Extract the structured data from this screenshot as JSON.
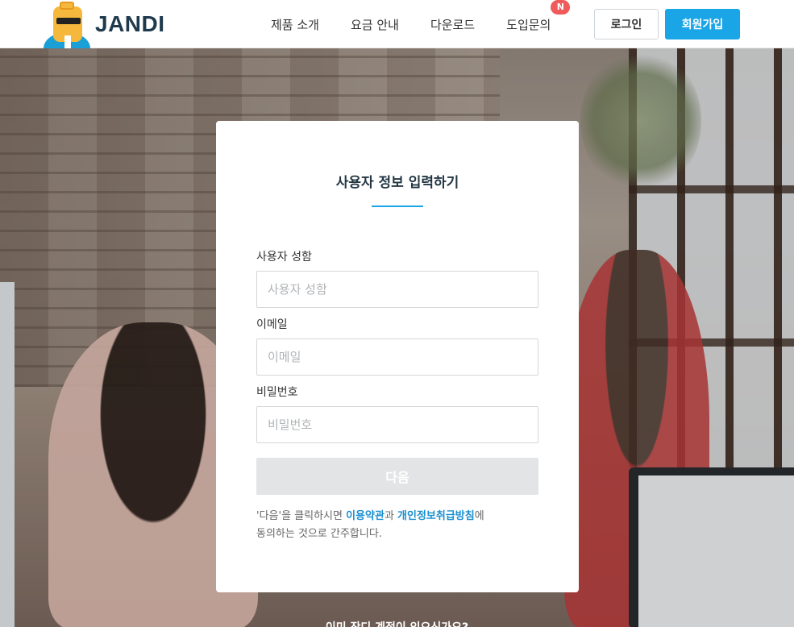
{
  "header": {
    "logo_text": "JANDI",
    "nav": [
      {
        "label": "제품 소개"
      },
      {
        "label": "요금 안내"
      },
      {
        "label": "다운로드"
      },
      {
        "label": "도입문의",
        "badge": "N"
      }
    ],
    "login_label": "로그인",
    "signup_label": "회원가입"
  },
  "form": {
    "title": "사용자 정보 입력하기",
    "fields": [
      {
        "label": "사용자 성함",
        "placeholder": "사용자 성함",
        "value": ""
      },
      {
        "label": "이메일",
        "placeholder": "이메일",
        "value": ""
      },
      {
        "label": "비밀번호",
        "placeholder": "비밀번호",
        "value": ""
      }
    ],
    "next_label": "다음",
    "terms": {
      "prefix": "'다음'을 클릭하시면 ",
      "link1": "이용약관",
      "middle": "과 ",
      "link2": "개인정보취급방침",
      "suffix": "에",
      "line2": "동의하는 것으로 간주합니다."
    }
  },
  "footer_hint": "이미 잔디 계정이 있으신가요?",
  "colors": {
    "accent": "#1aa5e6",
    "badge": "#f05a5a",
    "title": "#233743",
    "button_disabled": "#e3e4e5",
    "link": "#1a8fd0"
  },
  "icons": {
    "logo": "jandi-mascot-icon"
  }
}
